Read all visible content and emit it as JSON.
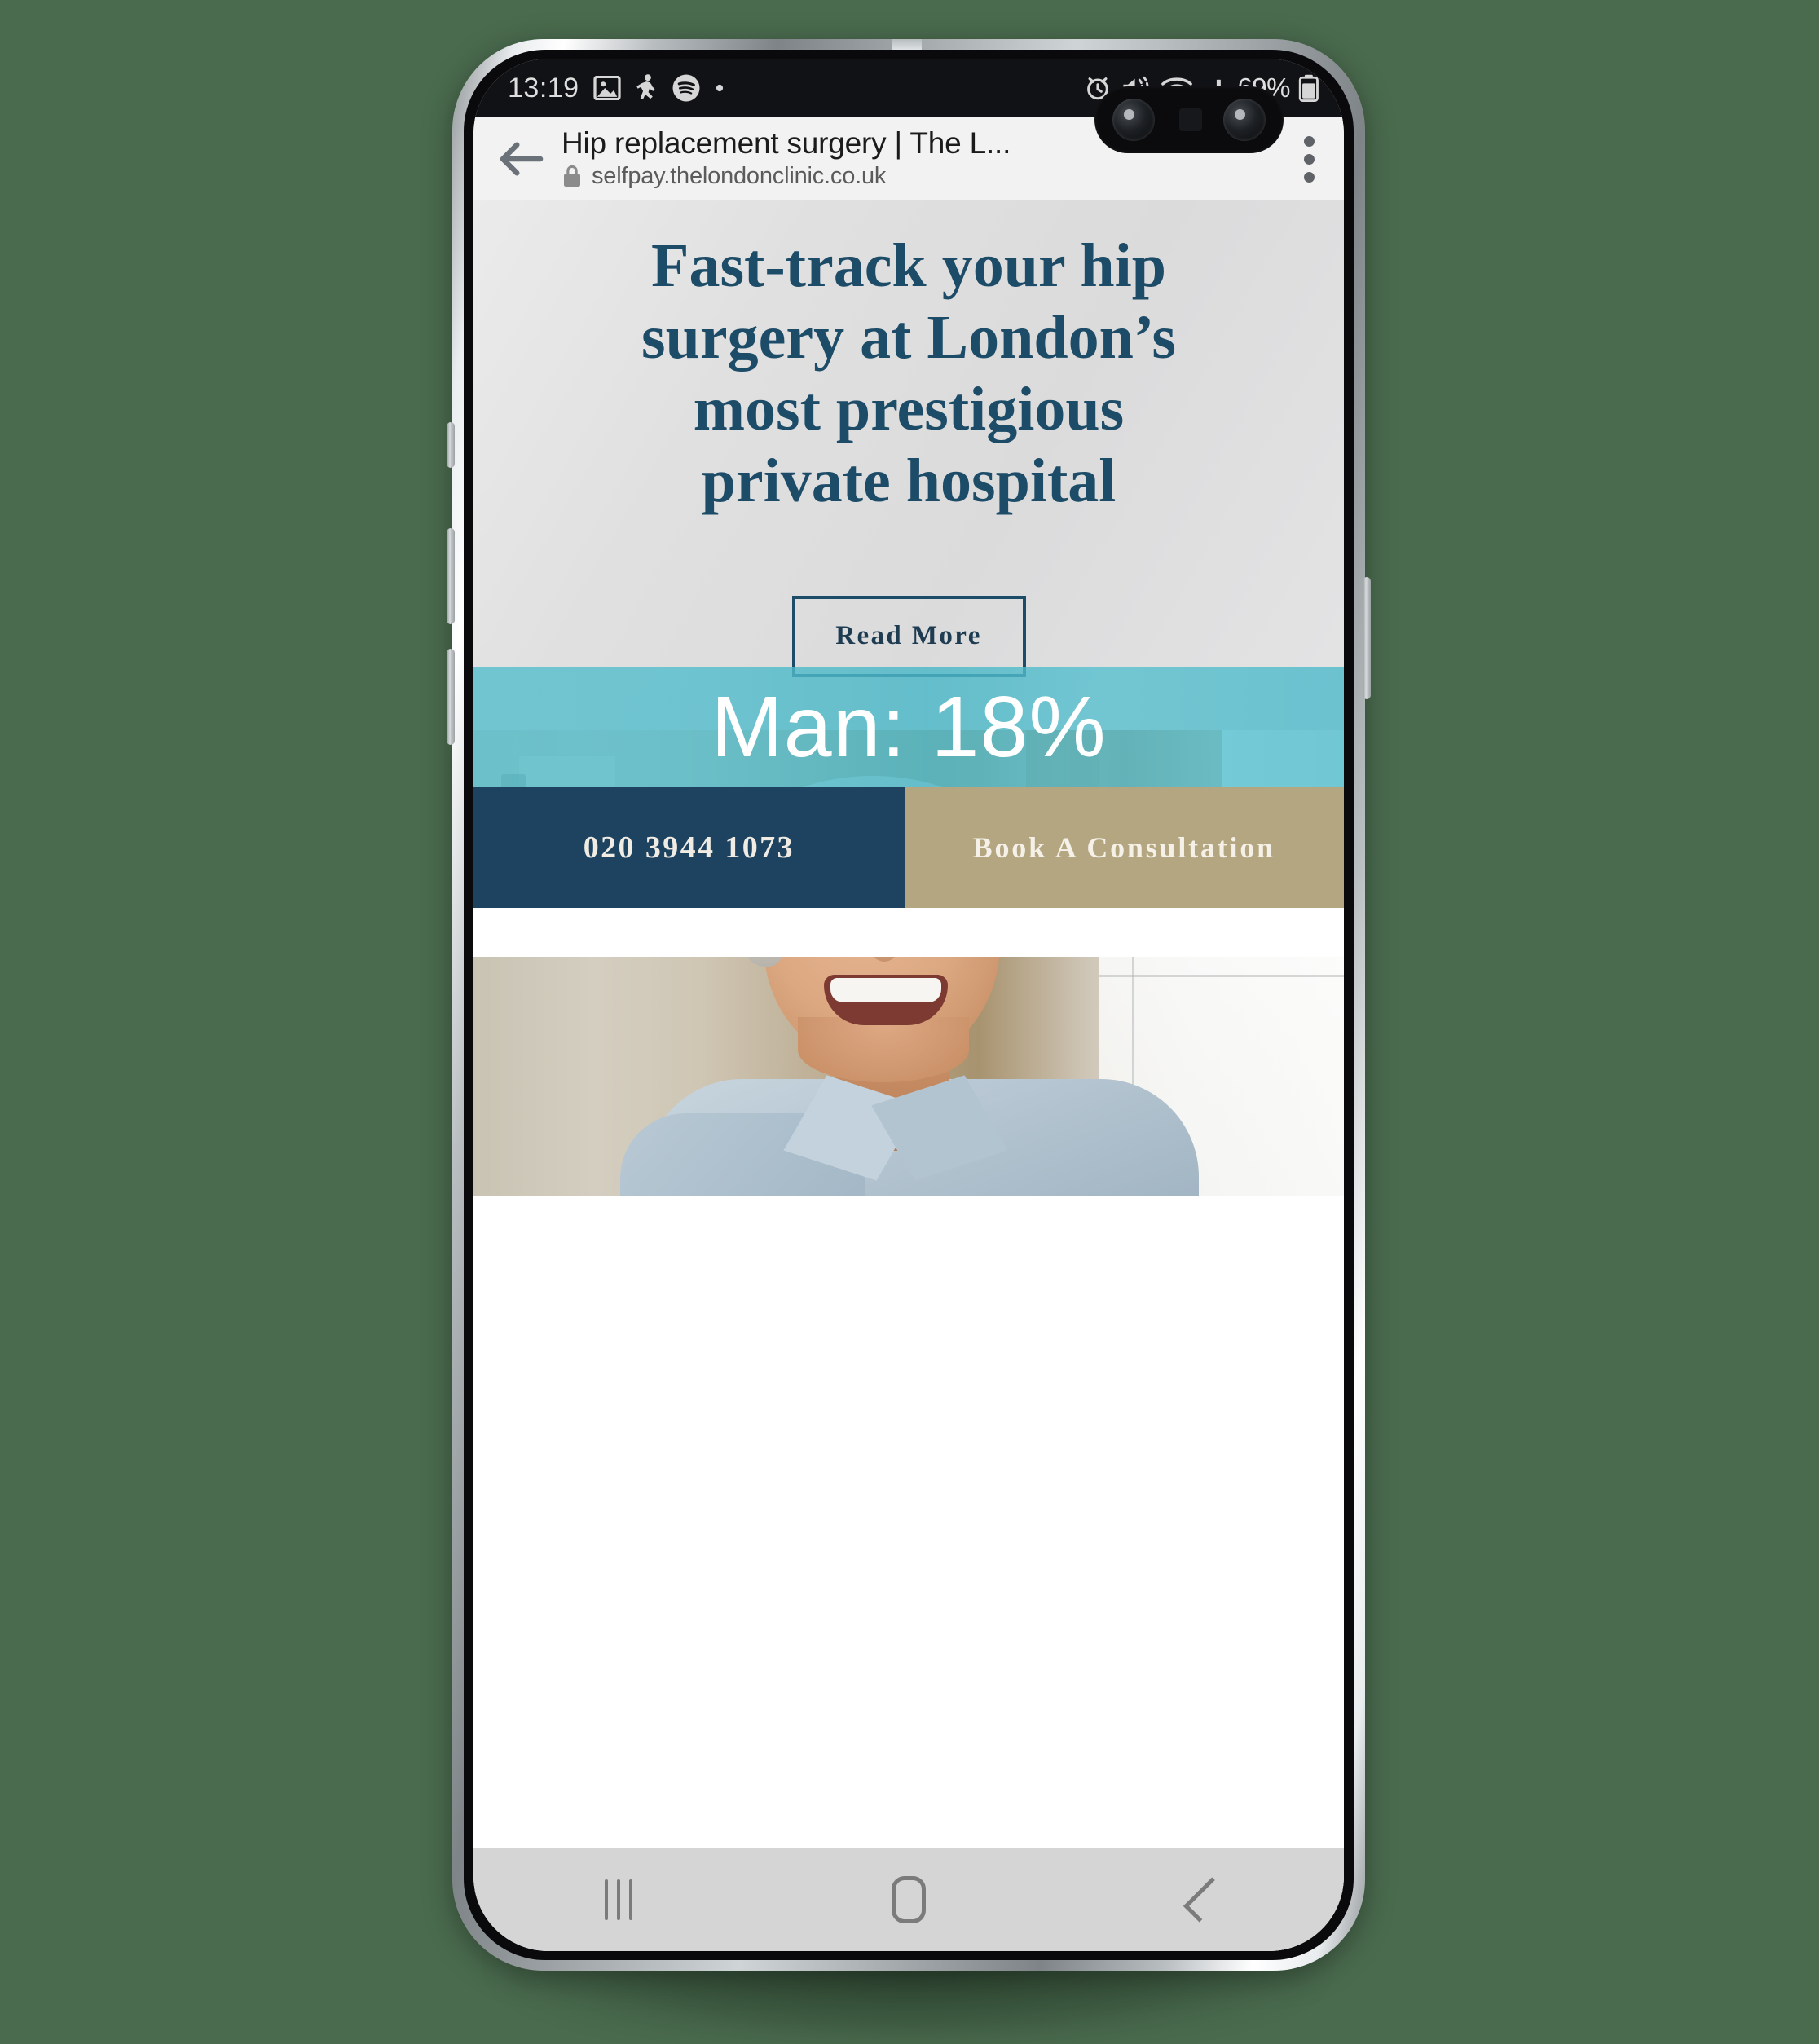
{
  "device": {
    "platform": "Android",
    "status_bar": {
      "clock": "13:19",
      "battery_percent": "69%",
      "left_icons": [
        "image-icon",
        "person-running-icon",
        "spotify-icon",
        "dot-icon"
      ],
      "right_icons": [
        "alarm-icon",
        "mute-vibrate-icon",
        "wifi-icon",
        "signal-bars-icon",
        "battery-icon"
      ]
    },
    "nav_bar": {
      "recents_label": "Recents",
      "home_label": "Home",
      "back_label": "Back",
      "icons": [
        "recents-icon",
        "home-icon",
        "back-icon"
      ]
    }
  },
  "browser": {
    "page_title": "Hip replacement surgery | The L...",
    "url": "selfpay.thelondonclinic.co.uk",
    "lock_icon": "lock-icon",
    "back_icon": "back-arrow-icon",
    "menu_icon": "kebab-menu-icon"
  },
  "page": {
    "hero": {
      "heading": "Fast-track your hip surgery at London’s most prestigious private hospital",
      "cta_label": "Read More",
      "heading_color": "#1d4c68"
    },
    "photo": {
      "alt": "Smiling older man in a light blue shirt seated in a bright room",
      "overlay_label": "Man: 18%",
      "overlay_color": "#4dbdcd"
    },
    "footer_cta": {
      "phone_number": "020 3944 1073",
      "phone_bg_color": "#1d4360",
      "book_label": "Book A Consultation",
      "book_bg_color": "#b3a680"
    }
  }
}
